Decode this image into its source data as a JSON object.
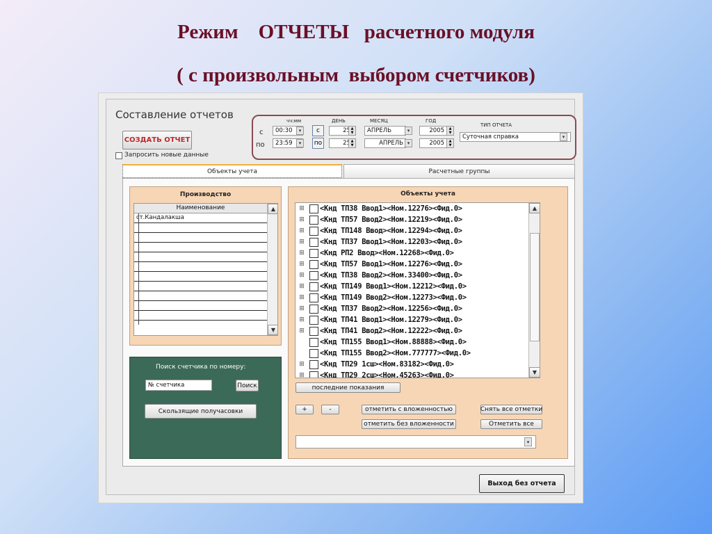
{
  "slide": {
    "title_line1": "Режим    ОТЧЕТЫ   расчетного модуля",
    "title_line2": "( с произвольным  выбором счетчиков)"
  },
  "app": {
    "title": "Составление отчетов",
    "create_button": "СОЗДАТЬ ОТЧЕТ",
    "request_new_data": "Запросить новые данные",
    "exit_button": "Выход без отчета"
  },
  "period": {
    "headers": {
      "time": "чч:мм",
      "day": "ДЕНЬ",
      "month": "МЕСЯЦ",
      "year": "ГОД",
      "report_type": "ТИП ОТЧЕТА"
    },
    "from_label": "с",
    "to_label": "по",
    "from": {
      "time": "00:30",
      "btn": "с",
      "day": "25",
      "month": "АПРЕЛЬ",
      "year": "2005"
    },
    "to": {
      "time": "23:59",
      "btn": "по",
      "day": "25",
      "month": "АПРЕЛЬ",
      "year": "2005"
    },
    "report_type_value": "Суточная справка"
  },
  "tabs": [
    {
      "label": "Объекты учета"
    },
    {
      "label": "Расчетные группы"
    }
  ],
  "production": {
    "title": "Производство",
    "column_header": "Наименование",
    "rows": [
      "ст.Кандалакша",
      "",
      "",
      "",
      "",
      "",
      "",
      "",
      "",
      "",
      ""
    ]
  },
  "search": {
    "title": "Поиск счетчика по номеру:",
    "input_value": "№ счетчика",
    "search_button": "Поиск",
    "sliding_button": "Скользящие получасовки"
  },
  "objects": {
    "title": "Объекты учета",
    "items": [
      {
        "text": "<Кнд ТП38 Ввод1><Ном.12276><Фид.0>",
        "expandable": true
      },
      {
        "text": "<Кнд ТП57 Ввод2><Ном.12219><Фид.0>",
        "expandable": true
      },
      {
        "text": "<Кнд ТП148 Ввод><Ном.12294><Фид.0>",
        "expandable": true
      },
      {
        "text": "<Кнд ТП37 Ввод1><Ном.12203><Фид.0>",
        "expandable": true
      },
      {
        "text": "<Кнд РП2 Ввод><Ном.12268><Фид.0>",
        "expandable": true
      },
      {
        "text": "<Кнд ТП57 Ввод1><Ном.12276><Фид.0>",
        "expandable": true
      },
      {
        "text": "<Кнд ТП38 Ввод2><Ном.33400><Фид.0>",
        "expandable": true
      },
      {
        "text": "<Кнд ТП149 Ввод1><Ном.12212><Фид.0>",
        "expandable": true
      },
      {
        "text": "<Кнд ТП149 Ввод2><Ном.12273><Фид.0>",
        "expandable": true
      },
      {
        "text": "<Кнд ТП37 Ввод2><Ном.12256><Фид.0>",
        "expandable": true
      },
      {
        "text": "<Кнд ТП41 Ввод1><Ном.12279><Фид.0>",
        "expandable": true
      },
      {
        "text": "<Кнд ТП41 Ввод2><Ном.12222><Фид.0>",
        "expandable": true
      },
      {
        "text": "<Кнд ТП155 Ввод1><Ном.88888><Фид.0>",
        "expandable": false
      },
      {
        "text": "<Кнд ТП155 Ввод2><Ном.777777><Фид.0>",
        "expandable": false
      },
      {
        "text": "<Кнд ТП29 1сш><Ном.83182><Фид.0>",
        "expandable": true
      },
      {
        "text": "<Кнд ТП29 2сш><Ном.45263><Фид.0>",
        "expandable": true
      }
    ],
    "last_readings_button": "последние показания",
    "plus_button": "+",
    "minus_button": "-",
    "mark_nested_button": "отметить с вложенностью",
    "mark_no_nested_button": "отметить без вложенности",
    "unmark_all_button": "Снять все отметки",
    "mark_all_button": "Отметить все"
  }
}
